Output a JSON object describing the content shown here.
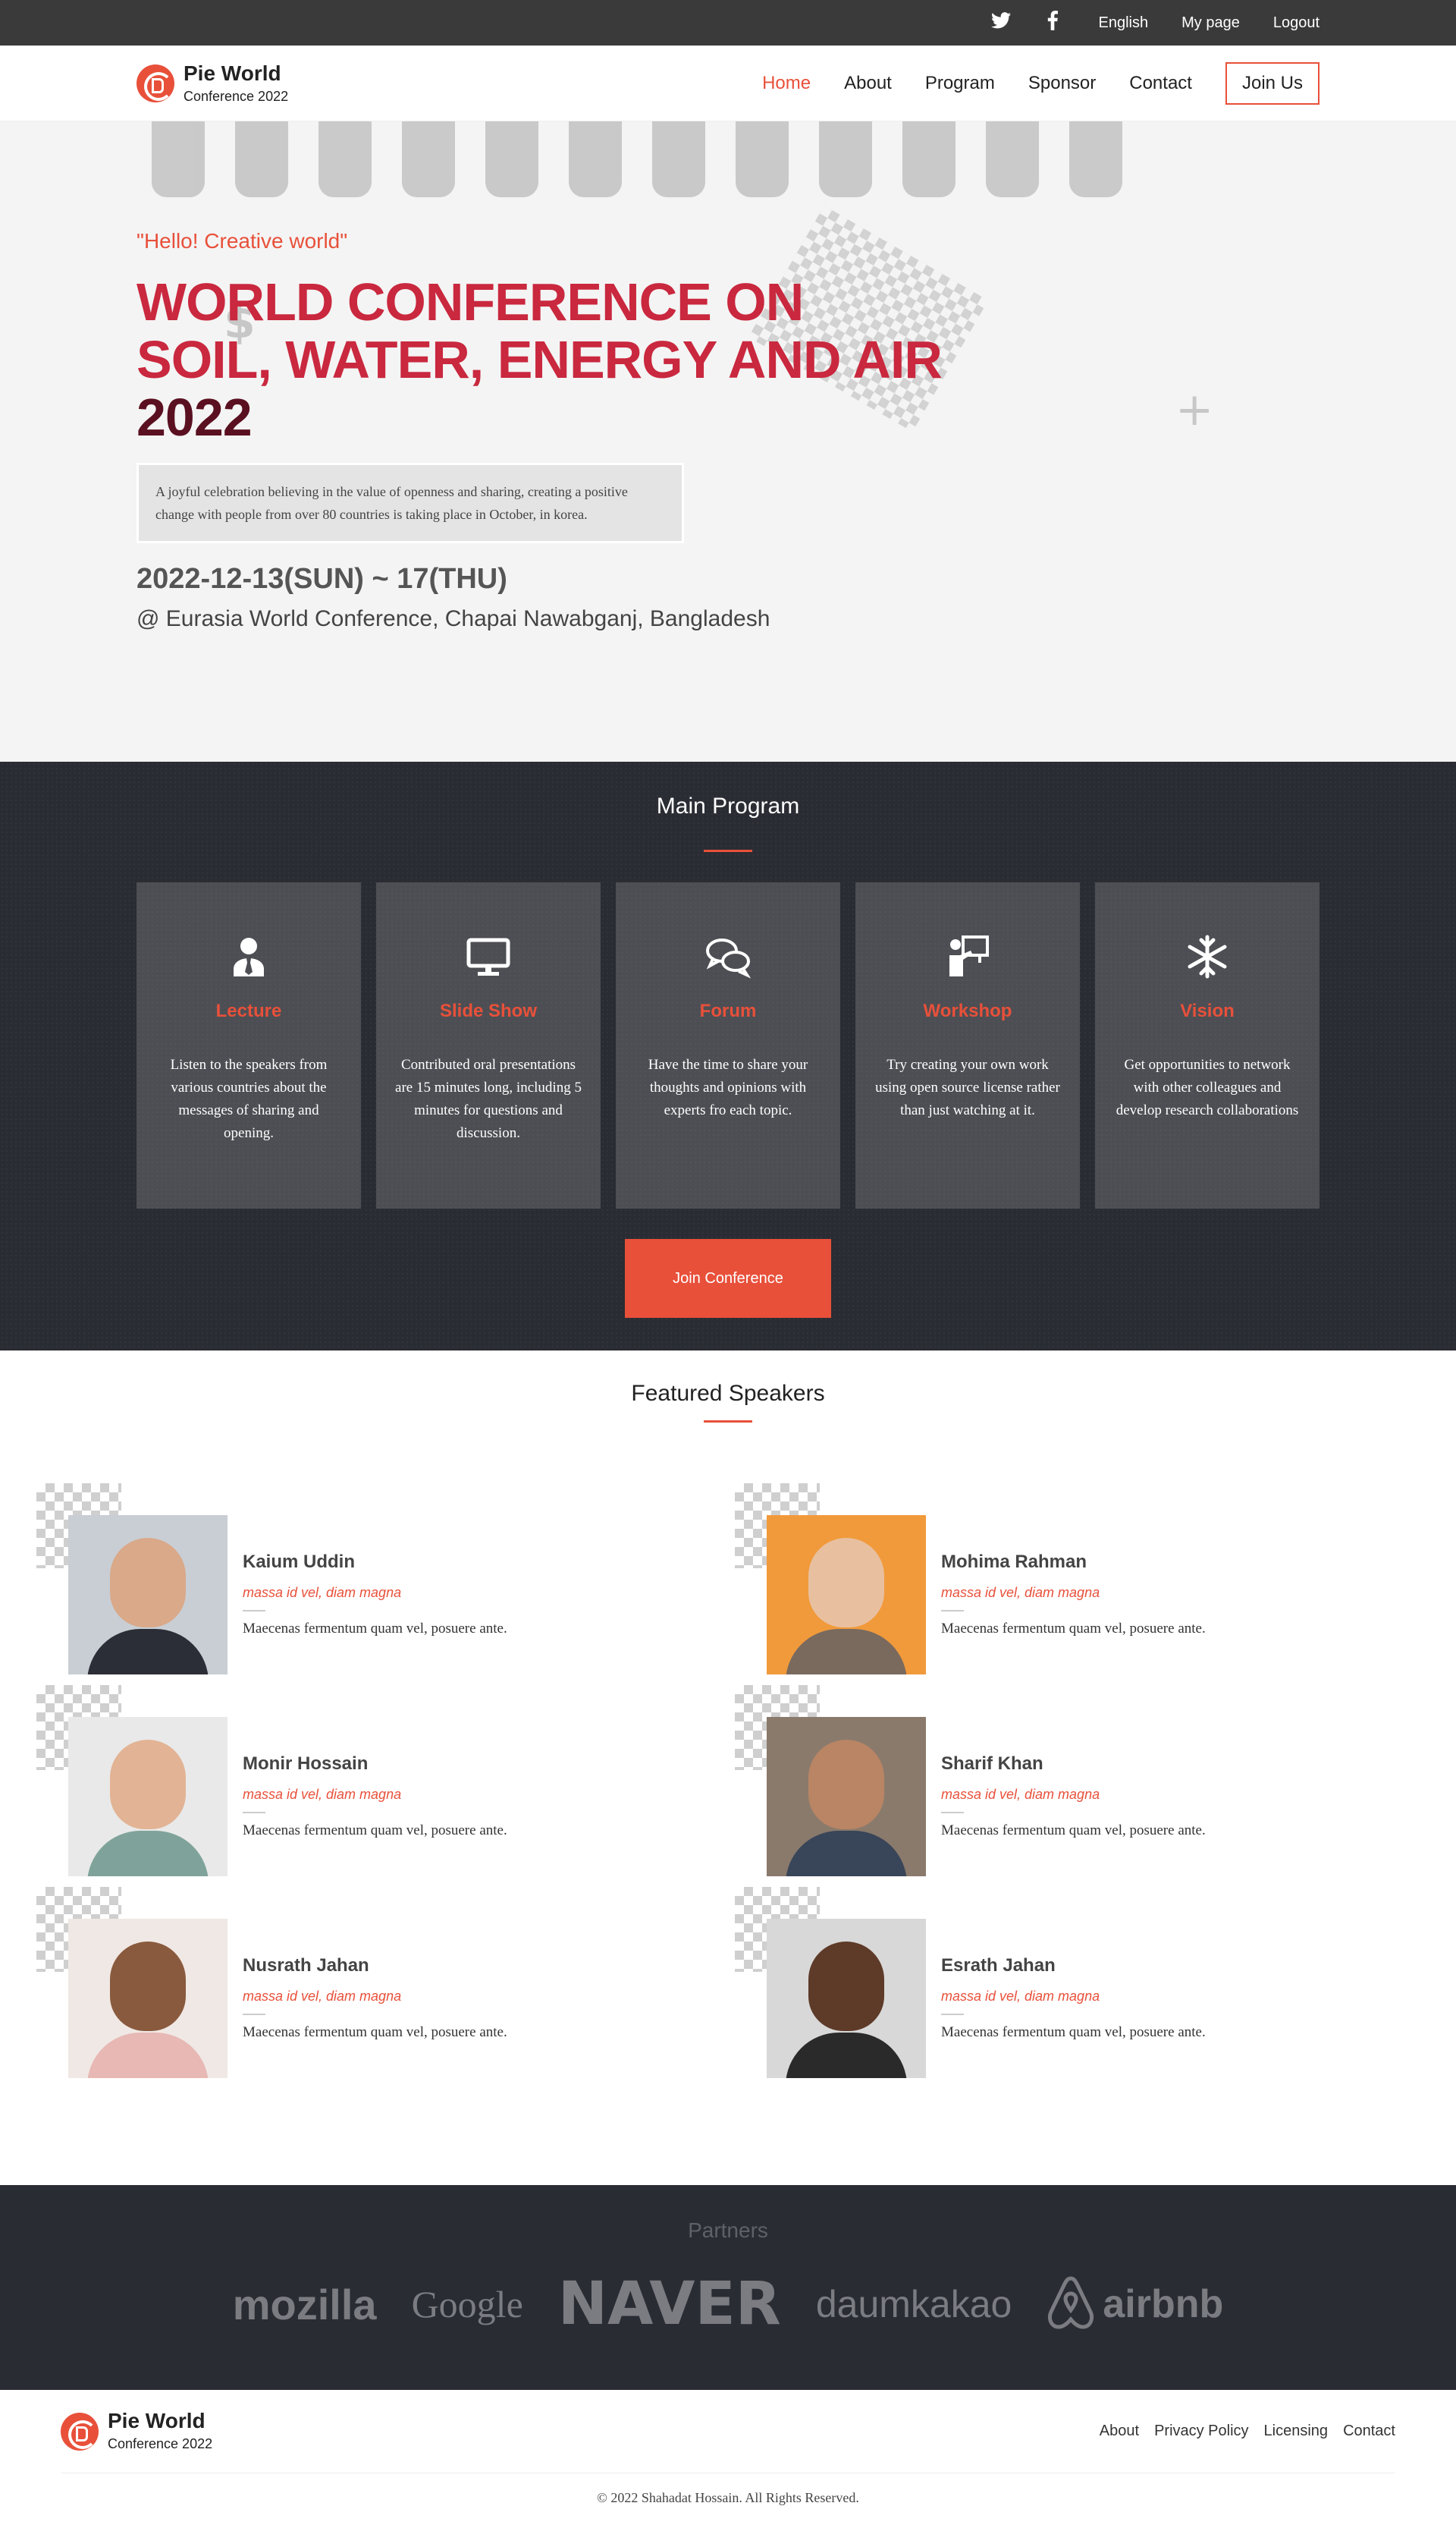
{
  "topbar": {
    "social": [
      "twitter-icon",
      "facebook-icon"
    ],
    "links": [
      "English",
      "My page",
      "Logout"
    ]
  },
  "header": {
    "brand_name": "Pie World",
    "brand_sub": "Conference 2022",
    "nav": [
      "Home",
      "About",
      "Program",
      "Sponsor",
      "Contact"
    ],
    "join": "Join Us"
  },
  "hero": {
    "hello": "\"Hello! Creative world\"",
    "title_line1": "WORLD CONFERENCE ON",
    "title_line2": "SOIL, WATER, ENERGY AND AIR",
    "title_line3": "2022",
    "description": "A joyful celebration believing in the value of openness and sharing, creating a positive change with people from over 80 countries is taking place in October, in korea.",
    "date": "2022-12-13(SUN) ~ 17(THU)",
    "venue": "@ Eurasia World Conference, Chapai Nawabganj, Bangladesh"
  },
  "program": {
    "title": "Main Program",
    "cards": [
      {
        "icon": "lecture-icon",
        "title": "Lecture",
        "text": "Listen to the speakers from various countries about the messages of sharing and opening."
      },
      {
        "icon": "monitor-icon",
        "title": "Slide Show",
        "text": "Contributed oral presentations are 15 minutes long, including 5 minutes for questions and discussion."
      },
      {
        "icon": "chat-icon",
        "title": "Forum",
        "text": "Have the time to share your thoughts and opinions with experts fro each topic."
      },
      {
        "icon": "presenter-icon",
        "title": "Workshop",
        "text": "Try creating your own work using open source license rather than just watching at it."
      },
      {
        "icon": "snowflake-icon",
        "title": "Vision",
        "text": "Get opportunities to network with other colleagues and develop research collaborations"
      }
    ],
    "button": "Join Conference"
  },
  "speakers": {
    "title": "Featured Speakers",
    "items": [
      {
        "name": "Kaium Uddin",
        "role": "massa id vel, diam magna",
        "bio": "Maecenas fermentum quam vel, posuere ante.",
        "skin": "#d9a98a",
        "shirt": "#2b2e36",
        "bg": "#c9ced4"
      },
      {
        "name": "Mohima Rahman",
        "role": "massa id vel, diam magna",
        "bio": "Maecenas fermentum quam vel, posuere ante.",
        "skin": "#e8c0a0",
        "shirt": "#7a6a5e",
        "bg": "#f19a3b"
      },
      {
        "name": "Monir Hossain",
        "role": "massa id vel, diam magna",
        "bio": "Maecenas fermentum quam vel, posuere ante.",
        "skin": "#e2b394",
        "shirt": "#7fa39a",
        "bg": "#e9e9e9"
      },
      {
        "name": "Sharif Khan",
        "role": "massa id vel, diam magna",
        "bio": "Maecenas fermentum quam vel, posuere ante.",
        "skin": "#b98564",
        "shirt": "#394558",
        "bg": "#8a7a6c"
      },
      {
        "name": "Nusrath Jahan",
        "role": "massa id vel, diam magna",
        "bio": "Maecenas fermentum quam vel, posuere ante.",
        "skin": "#8a5a3e",
        "shirt": "#e7b8b4",
        "bg": "#f0e8e4"
      },
      {
        "name": "Esrath Jahan",
        "role": "massa id vel, diam magna",
        "bio": "Maecenas fermentum quam vel, posuere ante.",
        "skin": "#5e3a28",
        "shirt": "#2a2a2a",
        "bg": "#d8d8d8"
      }
    ]
  },
  "partners": {
    "title": "Partners",
    "logos": [
      "mozilla",
      "Google",
      "NAVER",
      "daumkakao",
      "airbnb"
    ]
  },
  "footer": {
    "brand_name": "Pie World",
    "brand_sub": "Conference 2022",
    "links": [
      "About",
      "Privacy Policy",
      "Licensing",
      "Contact"
    ],
    "copyright": "© 2022 Shahadat Hossain. All Rights Reserved."
  },
  "colors": {
    "accent": "#e8503a",
    "dark": "#2a2c33",
    "title": "#c9283e"
  }
}
